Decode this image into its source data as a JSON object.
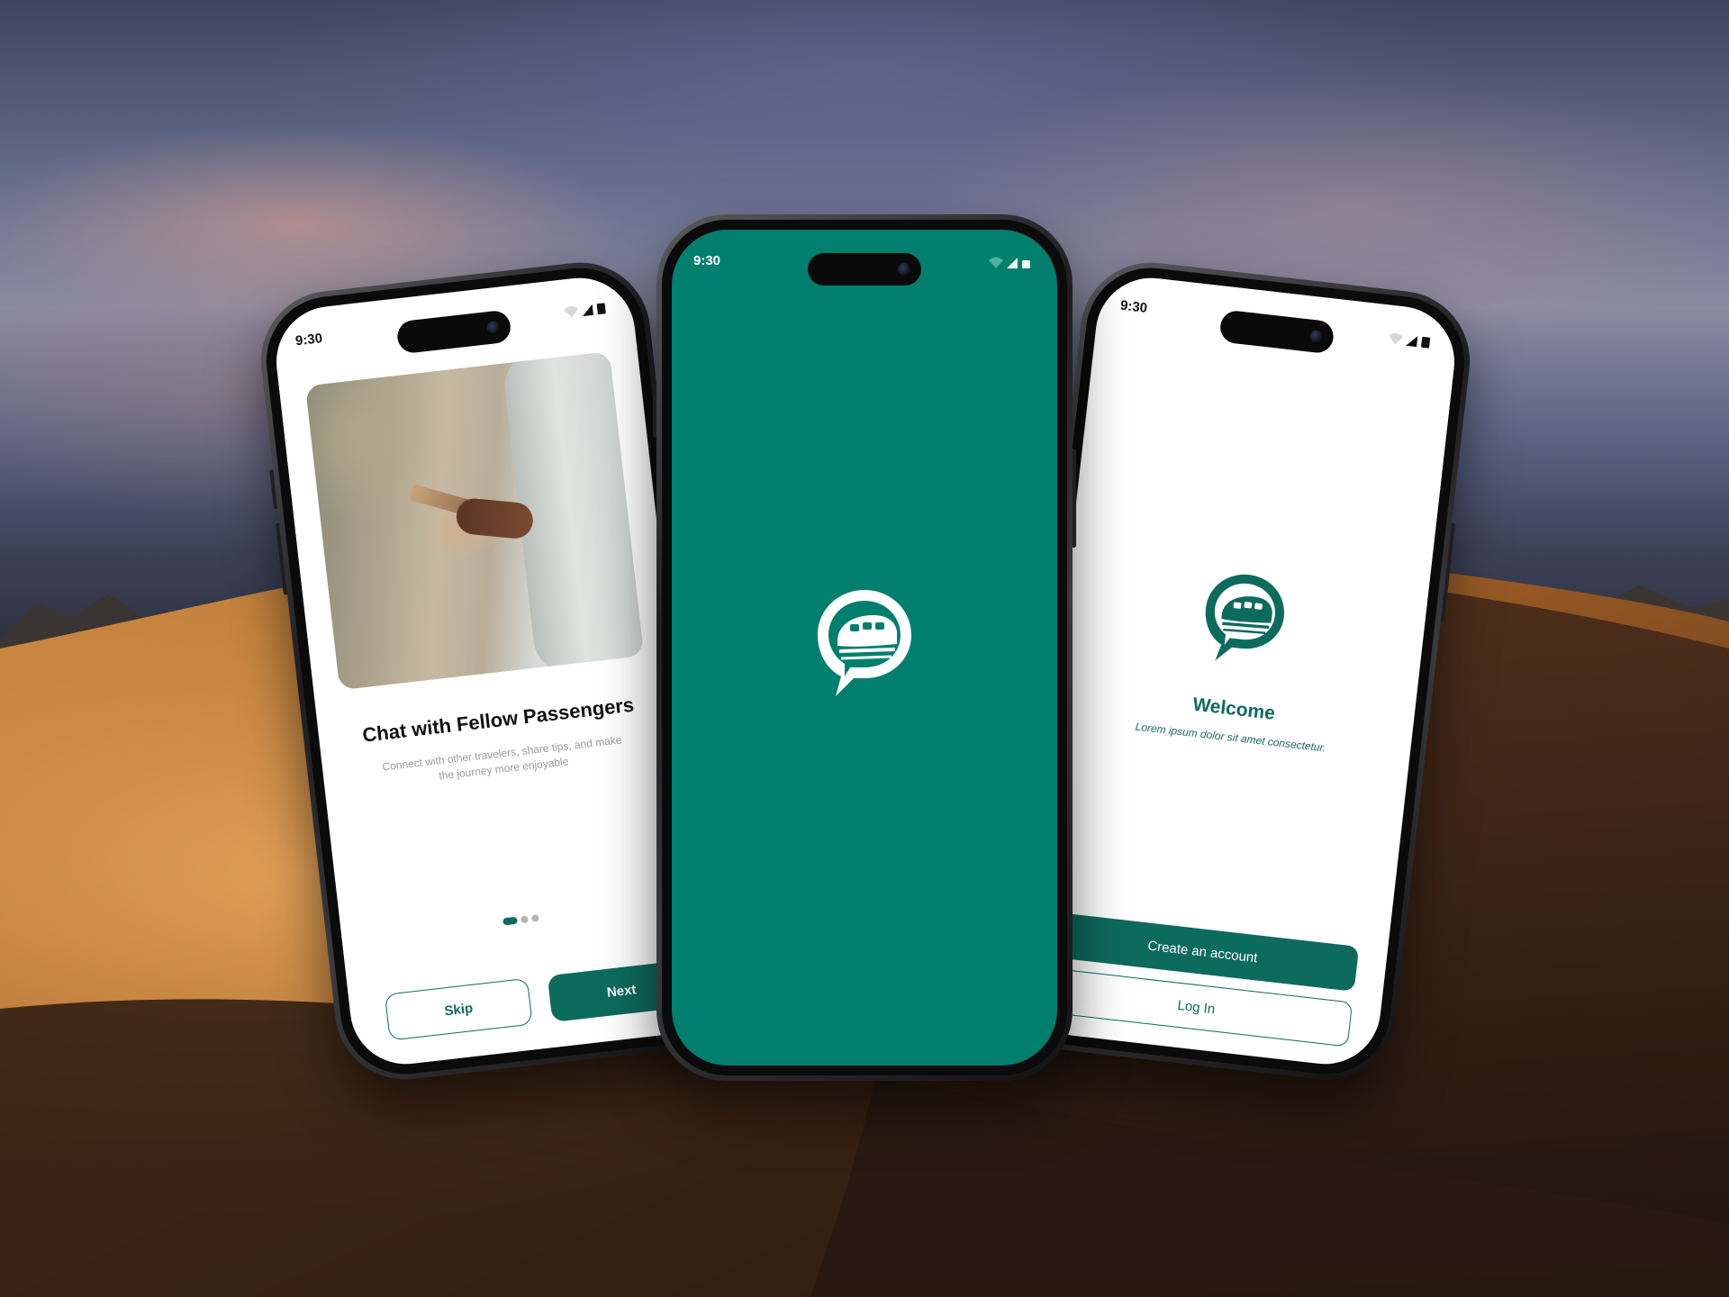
{
  "colors": {
    "brand_green": "#007f6e",
    "brand_dark_green": "#0d6b5d",
    "dot_inactive": "#b4b4b4"
  },
  "phones": {
    "left": {
      "status": {
        "time": "9:30"
      },
      "onboarding": {
        "image": "person-holding-phone-photo",
        "title": "Chat with Fellow Passengers",
        "subtitle": "Connect with other travelers, share tips, and make the journey more enjoyable",
        "page_indicator": {
          "active": 1,
          "total": 3
        },
        "skip_label": "Skip",
        "next_label": "Next"
      }
    },
    "center": {
      "status": {
        "time": "9:30"
      },
      "splash": {
        "logo": "train-chat-bubble-logo"
      }
    },
    "right": {
      "status": {
        "time": "9:30"
      },
      "welcome": {
        "logo": "train-chat-bubble-logo",
        "title": "Welcome",
        "subtitle": "Lorem ipsum dolor sit amet consectetur.",
        "create_account_label": "Create an account",
        "login_label": "Log In"
      }
    }
  }
}
